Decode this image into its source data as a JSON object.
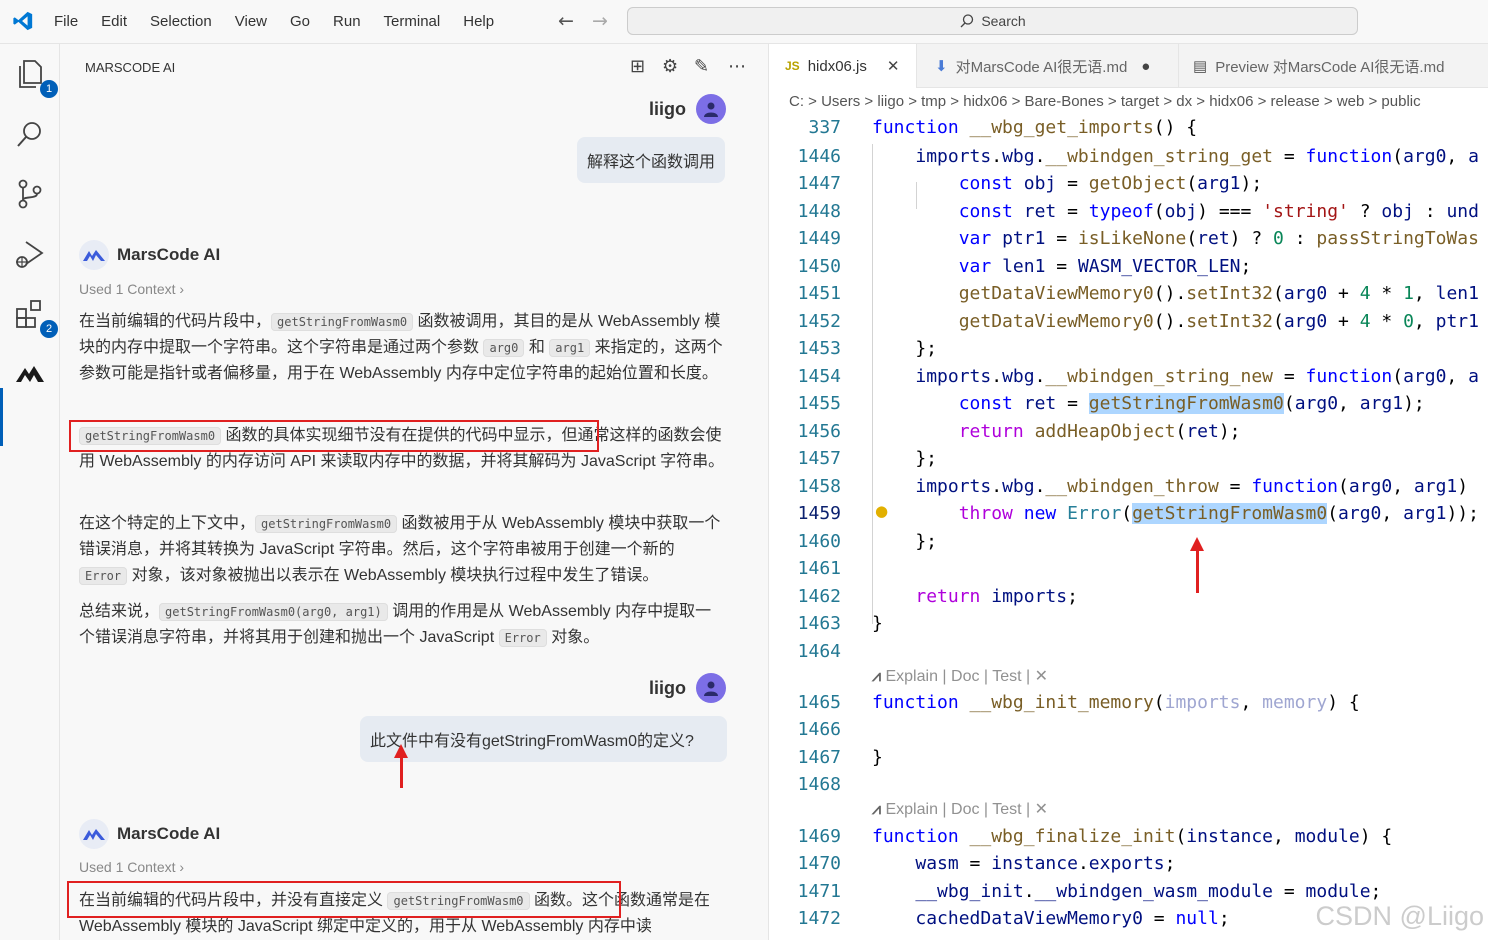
{
  "titlebar": {
    "menu": [
      "File",
      "Edit",
      "Selection",
      "View",
      "Go",
      "Run",
      "Terminal",
      "Help"
    ],
    "search": "Search"
  },
  "activity": {
    "explorer_badge": "1",
    "extensions_badge": "2"
  },
  "chat": {
    "title": "MARSCODE AI",
    "user_name": "liigo",
    "q1": "解释这个函数调用",
    "ai_name": "MarsCode AI",
    "used_context": "Used 1 Context",
    "a1_p1_a": "在当前编辑的代码片段中，",
    "a1_p1_code": "getStringFromWasm0",
    "a1_p1_b": "函数被调用，其目的是从 WebAssembly 模块的内存中提取一个字符串。这个字符串是通过两个参数",
    "a1_p1_arg0": "arg0",
    "a1_p1_and": "和",
    "a1_p1_arg1": "arg1",
    "a1_p1_c": "来指定的，这两个参数可能是指针或者偏移量，用于在 WebAssembly 内存中定位字符串的起始位置和长度。",
    "a1_p2_code": "getStringFromWasm0",
    "a1_p2_a": "函数的具体实现细节没有在提供的代码中显示，",
    "a1_p2_b": "但通常这样的函数会使用 WebAssembly 的内存访问 API 来读取内存中的数据，并将其解码为 JavaScript 字符串。",
    "a1_p3_a": "在这个特定的上下文中，",
    "a1_p3_code": "getStringFromWasm0",
    "a1_p3_b": "函数被用于从 WebAssembly 模块中获取一个错误消息，并将其转换为 JavaScript 字符串。然后，这个字符串被用于创建一个新的",
    "a1_p3_error": "Error",
    "a1_p3_c": "对象，该对象被抛出以表示在 WebAssembly 模块执行过程中发生了错误。",
    "a1_p4_a": "总结来说，",
    "a1_p4_code": "getStringFromWasm0(arg0, arg1)",
    "a1_p4_b": "调用的作用是从 WebAssembly 内存中提取一个错误消息字符串，并将其用于创建和抛出一个 JavaScript",
    "a1_p4_error": "Error",
    "a1_p4_c": "对象。",
    "q2": "此文件中有没有getStringFromWasm0的定义?",
    "a2_p1_a": "在当前编辑的代码片段中，并没有直接定义",
    "a2_p1_code": "getStringFromWasm0",
    "a2_p1_b": "函数。",
    "a2_p1_c": "这个函数通常是在 WebAssembly 模块的 JavaScript 绑定中定义的，用于从 WebAssembly 内存中读"
  },
  "editor": {
    "tabs": [
      "hidx06.js",
      "对MarsCode AI很无语.md",
      "Preview 对MarsCode AI很无语.md"
    ],
    "breadcrumb": "C:  >  Users  >  liigo  >  tmp  >  hidx06  >  Bare-Bones  >  target  >  dx  >  hidx06  >  release  >  web  >  public",
    "codelens": "Explain | Doc | Test | ✕",
    "watermark": "CSDN @Liigo",
    "line_numbers": [
      "337",
      "1446",
      "1447",
      "1448",
      "1449",
      "1450",
      "1451",
      "1452",
      "1453",
      "1454",
      "1455",
      "1456",
      "1457",
      "1458",
      "1459",
      "1460",
      "1461",
      "1462",
      "1463",
      "1464",
      "1465",
      "1466",
      "1467",
      "1468",
      "1469",
      "1470",
      "1471",
      "1472"
    ]
  }
}
